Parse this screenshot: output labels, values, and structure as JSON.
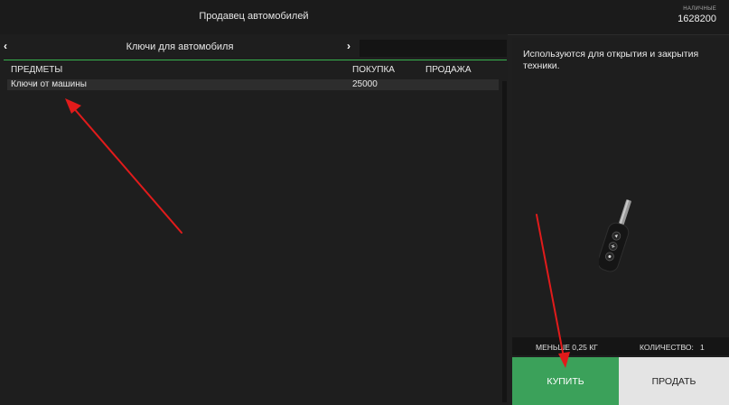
{
  "header": {
    "title": "Продавец автомобилей",
    "cash_label": "НАЛИЧНЫЕ",
    "cash_value": "1628200"
  },
  "tabs": {
    "prev_icon": "‹",
    "title": "Ключи для автомобиля",
    "next_icon": "›"
  },
  "table": {
    "columns": {
      "items": "ПРЕДМЕТЫ",
      "buy": "ПОКУПКА",
      "sell": "ПРОДАЖА"
    },
    "rows": [
      {
        "name": "Ключи от машины",
        "buy": "25000",
        "sell": ""
      }
    ]
  },
  "details": {
    "description": "Используются для открытия и закрытия техники.",
    "image_icon": "car-key-icon",
    "weight": "МЕНЬШЕ 0,25 КГ",
    "quantity_label": "КОЛИЧЕСТВО:",
    "quantity_value": "1",
    "buy_label": "КУПИТЬ",
    "sell_label": "ПРОДАТЬ"
  },
  "colors": {
    "accent": "#37b24d",
    "buy_button": "#3ba15a",
    "sell_button": "#e4e4e4",
    "annotation_arrow": "#e11b1b"
  }
}
